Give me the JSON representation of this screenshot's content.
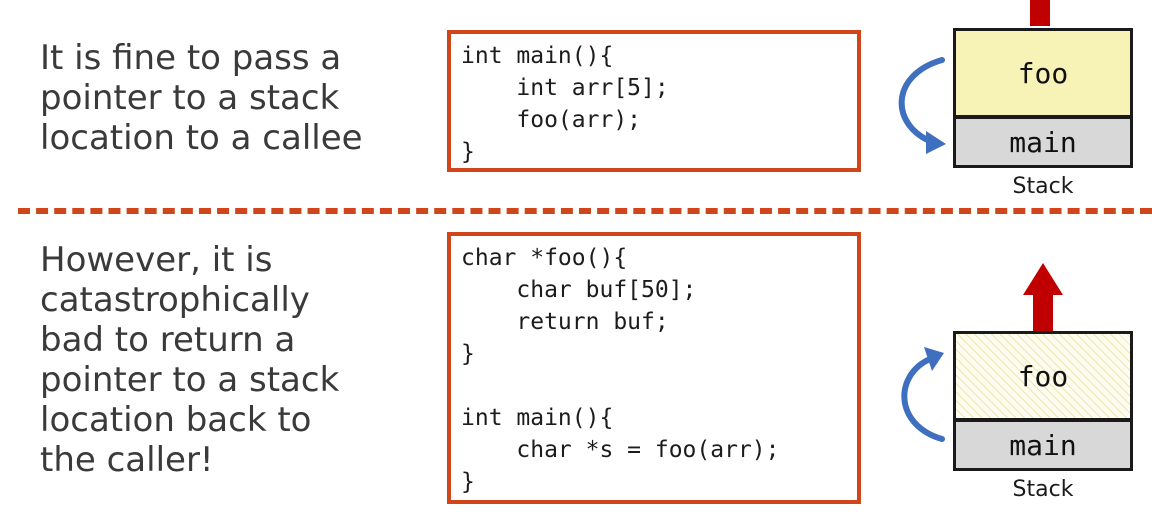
{
  "colors": {
    "accent": "#d0461a",
    "text": "#3a3a3a",
    "foo_frame": "#f7f3b7",
    "main_frame": "#d8d8d8",
    "curved_arrow": "#3f6fbf",
    "return_arrow": "#c00000"
  },
  "top": {
    "text": "It is fine to pass a\npointer to a stack\nlocation to a callee",
    "code": "int main(){\n    int arr[5];\n    foo(arr);\n}",
    "stack": {
      "upper_frame": "foo",
      "lower_frame": "main",
      "caption": "Stack"
    }
  },
  "bottom": {
    "text": "However, it is\ncatastrophically\nbad to return a\npointer to a stack\nlocation back to\nthe caller!",
    "code": "char *foo(){\n    char buf[50];\n    return buf;\n}\n\nint main(){\n    char *s = foo(arr);\n}",
    "stack": {
      "upper_frame": "foo",
      "lower_frame": "main",
      "caption": "Stack"
    }
  },
  "icons": {
    "curved_arrow_top": "curved-arrow-down-right",
    "curved_arrow_bottom": "curved-arrow-up-right",
    "return_arrow": "arrow-up-icon"
  }
}
